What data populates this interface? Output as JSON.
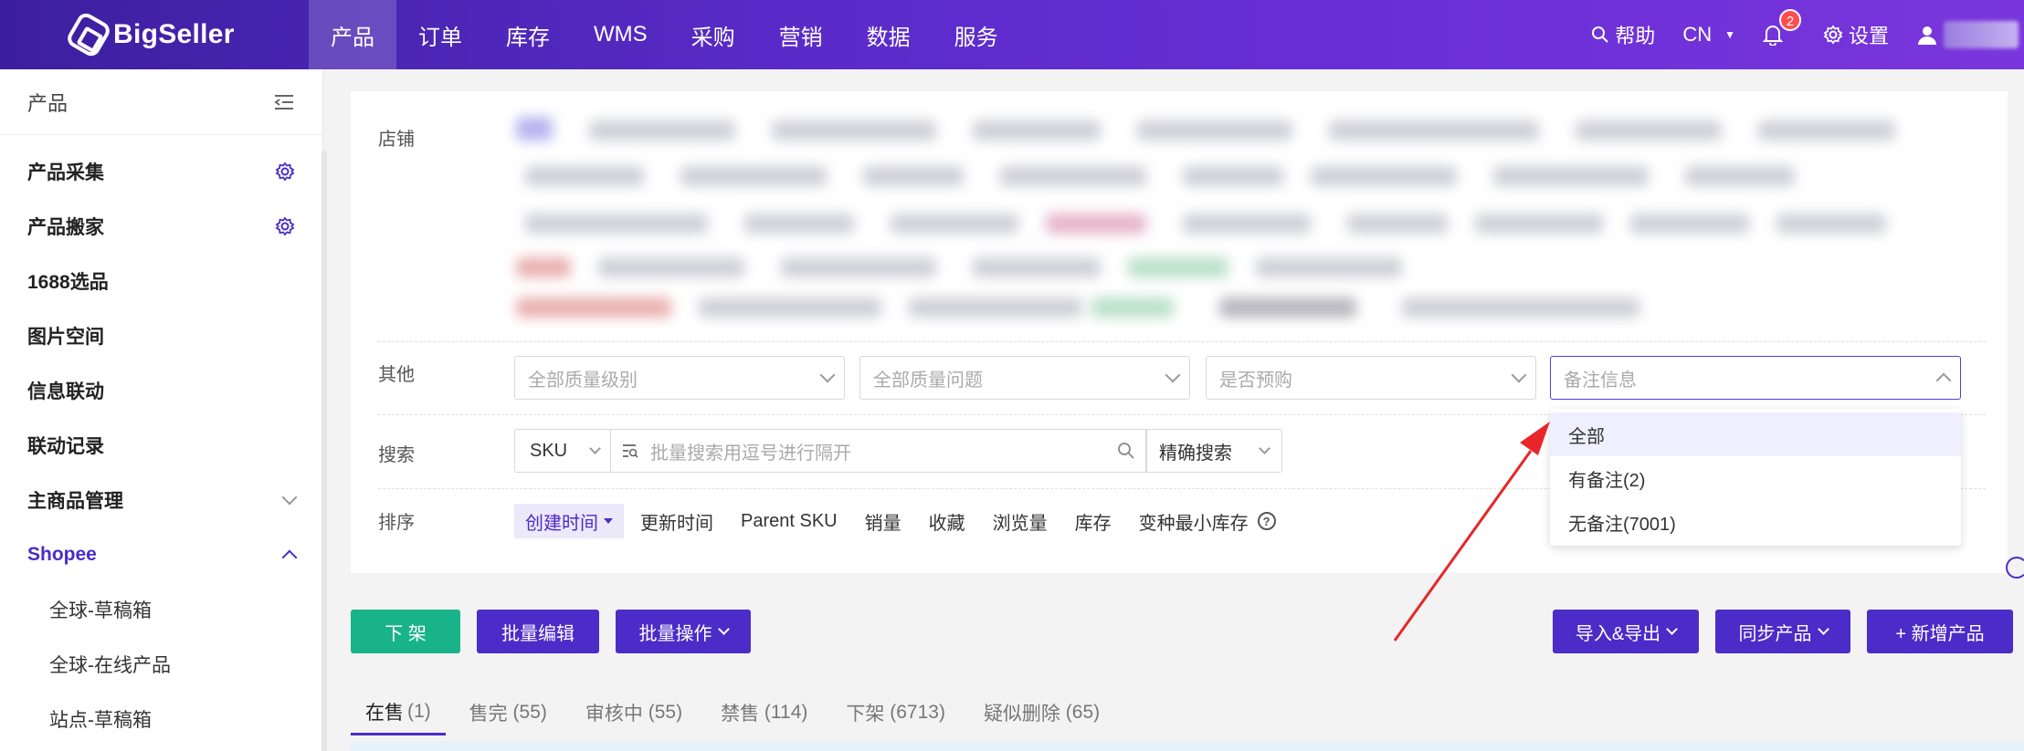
{
  "brand": {
    "name": "BigSeller"
  },
  "nav": {
    "items": [
      "产品",
      "订单",
      "库存",
      "WMS",
      "采购",
      "营销",
      "数据",
      "服务"
    ],
    "help": "帮助",
    "lang": "CN",
    "notifications": "2",
    "settings": "设置"
  },
  "sidebar": {
    "title": "产品",
    "items": [
      {
        "label": "产品采集"
      },
      {
        "label": "产品搬家"
      },
      {
        "label": "1688选品"
      },
      {
        "label": "图片空间"
      },
      {
        "label": "信息联动"
      },
      {
        "label": "联动记录"
      },
      {
        "label": "主商品管理"
      },
      {
        "label": "Shopee"
      }
    ],
    "subitems": [
      "全球-草稿箱",
      "全球-在线产品",
      "站点-草稿箱"
    ]
  },
  "filters": {
    "store_label": "店铺",
    "other_label": "其他",
    "search_label": "搜索",
    "sort_label": "排序",
    "quality_level": "全部质量级别",
    "quality_issue": "全部质量问题",
    "preorder": "是否预购",
    "remark": "备注信息",
    "remark_options": [
      "全部",
      "有备注(2)",
      "无备注(7001)"
    ],
    "search_type": "SKU",
    "search_placeholder": "批量搜索用逗号进行隔开",
    "exact_search": "精确搜索",
    "sorts": [
      "创建时间",
      "更新时间",
      "Parent SKU",
      "销量",
      "收藏",
      "浏览量",
      "库存",
      "变种最小库存"
    ]
  },
  "actions": {
    "delist": "下 架",
    "batch_edit": "批量编辑",
    "batch_ops": "批量操作",
    "import_export": "导入&导出",
    "sync": "同步产品",
    "add": "+ 新增产品"
  },
  "tabs": [
    {
      "label": "在售",
      "count": "(1)"
    },
    {
      "label": "售完",
      "count": "(55)"
    },
    {
      "label": "审核中",
      "count": "(55)"
    },
    {
      "label": "禁售",
      "count": "(114)"
    },
    {
      "label": "下架",
      "count": "(6713)"
    },
    {
      "label": "疑似删除",
      "count": "(65)"
    }
  ],
  "colors": {
    "brand": "#4b2cc8",
    "green": "#19b38a",
    "alert": "#e8262a"
  }
}
